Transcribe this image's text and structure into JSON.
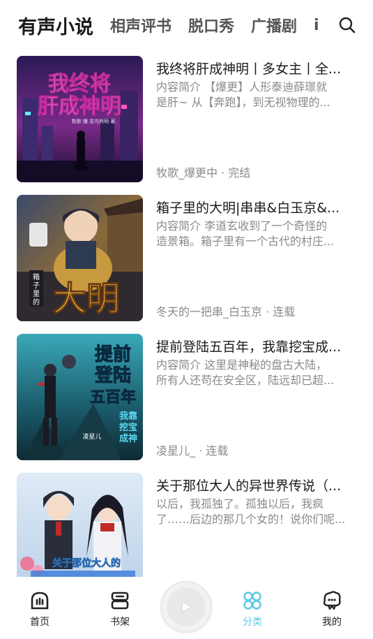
{
  "tabs": [
    {
      "label": "有声小说",
      "active": true
    },
    {
      "label": "相声评书"
    },
    {
      "label": "脱口秀"
    },
    {
      "label": "广播剧"
    },
    {
      "label": "i"
    }
  ],
  "books": [
    {
      "title": "我终将肝成神明丨多女主丨全...",
      "desc_prefix": "内容简介",
      "desc_line1": " 【爆更】人形泰迪薛璟就",
      "desc_line2": "是肝~ 从【奔跑】，到无视物理的...",
      "meta": "牧歌_爆更中 · 完结",
      "cover_text": [
        "我终将",
        "肝成神明"
      ],
      "cover_author": "牧歌·播  花鸟熊明  著"
    },
    {
      "title": "箱子里的大明|串串&白玉京&...",
      "desc_prefix": "内容简介",
      "desc_line1": " 李道玄收到了一个奇怪的",
      "desc_line2": "造景箱。箱子里有一个古代的村庄...",
      "meta": "冬天的一把串_白玉京 · 连载",
      "cover_text": [
        "大明"
      ],
      "cover_small": [
        "箱",
        "子",
        "里",
        "的"
      ]
    },
    {
      "title": "提前登陆五百年，我靠挖宝成...",
      "desc_prefix": "内容简介",
      "desc_line1": " 这里是神秘的盘古大陆，",
      "desc_line2": "所有人还苟在安全区，陆远却已超...",
      "meta": "凌星儿_ · 连载",
      "cover_text": [
        "提前",
        "登陆",
        "五百年"
      ],
      "cover_side": [
        "我靠",
        "挖宝",
        "成神"
      ],
      "cover_author": "凌星儿"
    },
    {
      "title": "关于那位大人的异世界传说（...",
      "desc_line1": "以后，我孤独了。孤独以后，我疯",
      "desc_line2": "了……后边的那几个女的！说你们呢...",
      "meta": "",
      "cover_text": [
        "关于那位大人的"
      ]
    }
  ],
  "nav": [
    {
      "label": "首页",
      "icon": "home-icon"
    },
    {
      "label": "书架",
      "icon": "bookshelf-icon"
    },
    {
      "label": "分类",
      "icon": "category-icon",
      "active": true
    },
    {
      "label": "我的",
      "icon": "profile-icon"
    }
  ],
  "colors": {
    "accent": "#5ac8e6",
    "text_primary": "#1a1a1a",
    "text_secondary": "#8a8a8a"
  }
}
